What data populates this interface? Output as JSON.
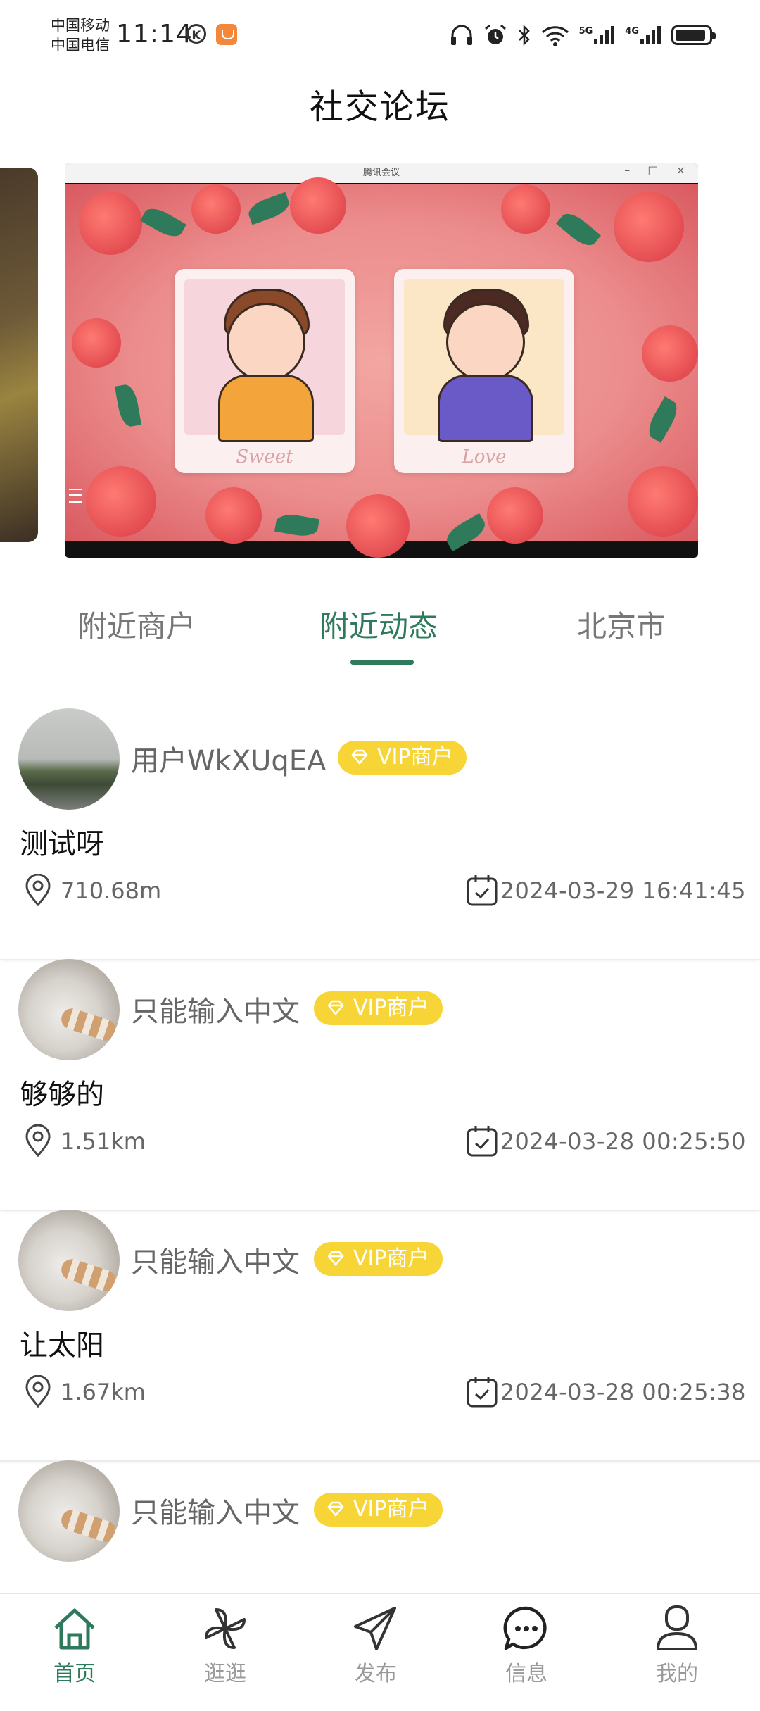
{
  "status_bar": {
    "carrier1": "中国移动",
    "carrier2": "中国电信",
    "time": "11:14",
    "k_badge": "K",
    "net_label1": "5G",
    "net_label2": "4G"
  },
  "page": {
    "title": "社交论坛"
  },
  "banner": {
    "window_title": "腾讯会议",
    "card1_caption": "Sweet",
    "card2_caption": "Love"
  },
  "tabs": [
    {
      "label": "附近商户",
      "active": false
    },
    {
      "label": "附近动态",
      "active": true
    },
    {
      "label": "北京市",
      "active": false
    }
  ],
  "posts": [
    {
      "username": "用户WkXUqEA",
      "badge": "VIP商户",
      "text": "测试呀",
      "distance": "710.68m",
      "time": "2024-03-29 16:41:45",
      "avatar": "landscape-avatar"
    },
    {
      "username": "只能输入中文",
      "badge": "VIP商户",
      "text": "够够的",
      "distance": "1.51km",
      "time": "2024-03-28 00:25:50",
      "avatar": "cat-avatar"
    },
    {
      "username": "只能输入中文",
      "badge": "VIP商户",
      "text": "让太阳",
      "distance": "1.67km",
      "time": "2024-03-28 00:25:38",
      "avatar": "cat-avatar"
    },
    {
      "username": "只能输入中文",
      "badge": "VIP商户",
      "text": "",
      "distance": "",
      "time": "",
      "avatar": "cat-avatar"
    }
  ],
  "bottom_nav": [
    {
      "label": "首页",
      "icon": "home-icon",
      "active": true
    },
    {
      "label": "逛逛",
      "icon": "pinwheel-icon",
      "active": false
    },
    {
      "label": "发布",
      "icon": "paper-plane-icon",
      "active": false
    },
    {
      "label": "信息",
      "icon": "chat-bubble-icon",
      "active": false
    },
    {
      "label": "我的",
      "icon": "user-icon",
      "active": false
    }
  ],
  "colors": {
    "accent": "#2e7a5c",
    "vip": "#f8d536",
    "muted_text": "#666666"
  }
}
